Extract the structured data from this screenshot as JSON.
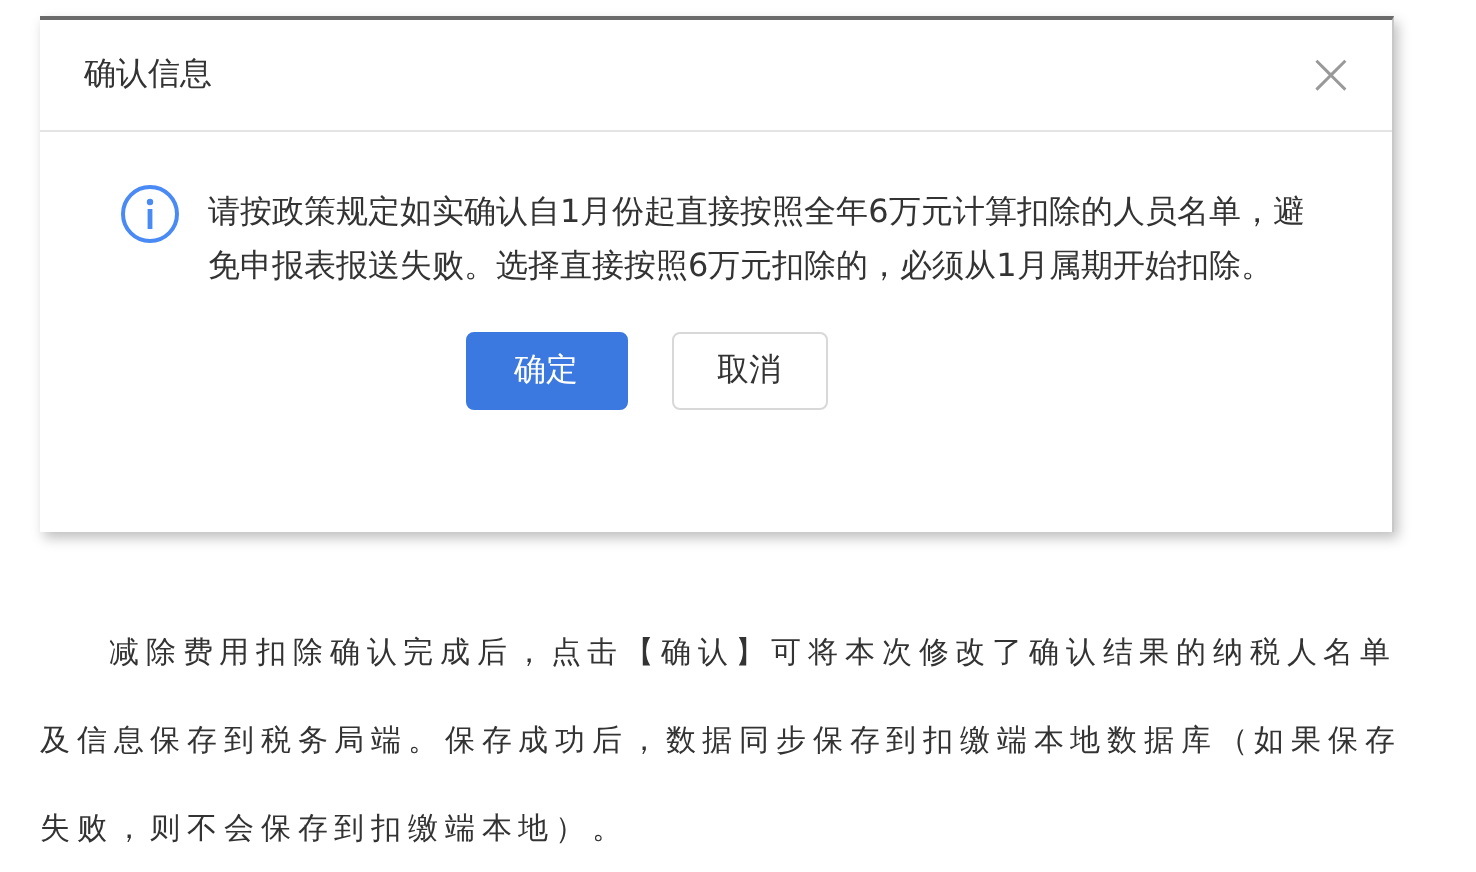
{
  "dialog": {
    "title": "确认信息",
    "close": "×",
    "message": "请按政策规定如实确认自1月份起直接按照全年6万元计算扣除的人员名单，避免申报表报送失败。选择直接按照6万元扣除的，必须从1月属期开始扣除。",
    "buttons": [
      {
        "label": "确定",
        "kind": "primary"
      },
      {
        "label": "取消",
        "kind": "secondary"
      }
    ]
  },
  "article": {
    "paragraph": "减除费用扣除确认完成后，点击【确认】可将本次修改了确认结果的纳税人名单及信息保存到税务局端。保存成功后，数据同步保存到扣缴端本地数据库（如果保存失败，则不会保存到扣缴端本地）。"
  }
}
